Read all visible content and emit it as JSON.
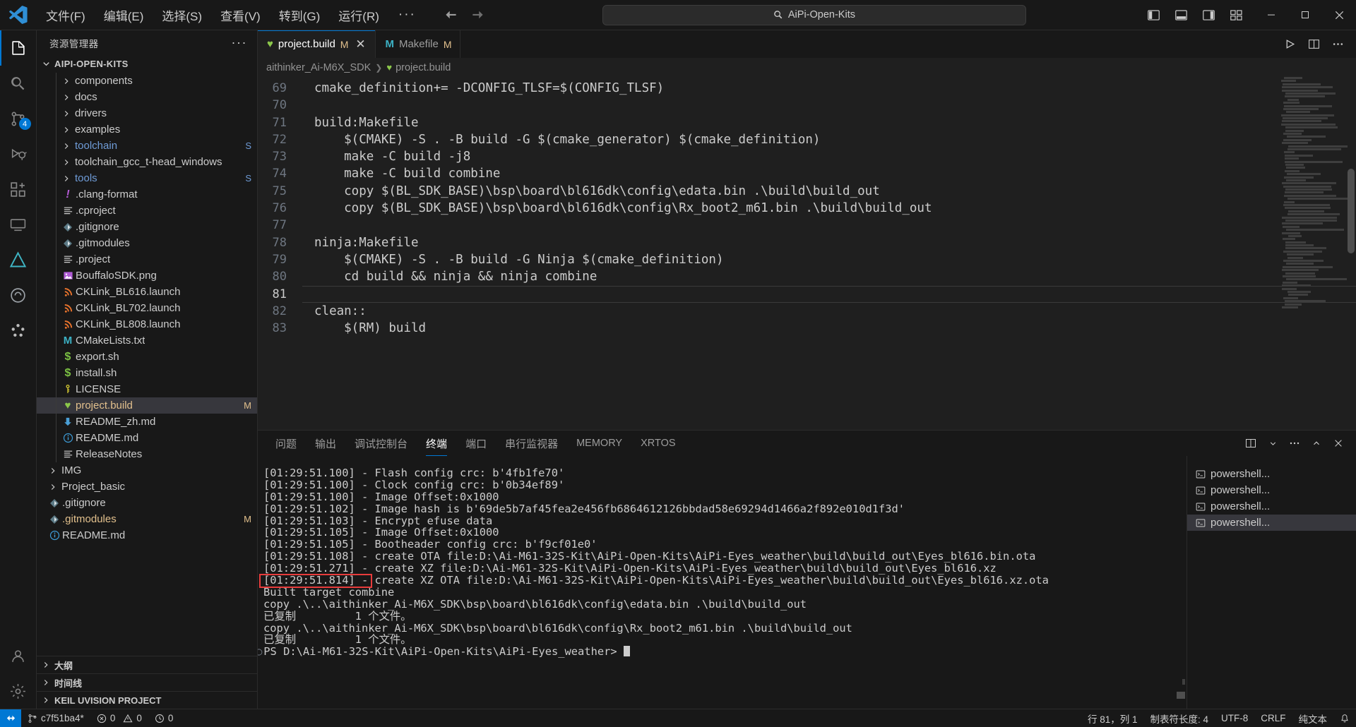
{
  "window": {
    "title": "AiPi-Open-Kits",
    "menu": [
      "文件(F)",
      "编辑(E)",
      "选择(S)",
      "查看(V)",
      "转到(G)",
      "运行(R)"
    ],
    "menu_overflow": "···",
    "search_placeholder": "AiPi-Open-Kits",
    "controls": {
      "minimize": "—",
      "maximize": "▢",
      "close": "✕"
    }
  },
  "activitybar": {
    "items": [
      {
        "name": "explorer",
        "badge": ""
      },
      {
        "name": "search",
        "badge": ""
      },
      {
        "name": "source-control",
        "badge": "4"
      },
      {
        "name": "run-and-debug",
        "badge": ""
      },
      {
        "name": "extensions",
        "badge": ""
      },
      {
        "name": "remote-explorer",
        "badge": ""
      },
      {
        "name": "platformio",
        "badge": ""
      },
      {
        "name": "copilot-chat",
        "badge": ""
      },
      {
        "name": "extension-pack",
        "badge": ""
      }
    ]
  },
  "explorer": {
    "header": "资源管理器",
    "header_more": "···",
    "root": "AIPI-OPEN-KITS",
    "items": [
      {
        "label": "components",
        "kind": "folder",
        "indent": 1,
        "badge": "",
        "color": ""
      },
      {
        "label": "docs",
        "kind": "folder",
        "indent": 1,
        "badge": "",
        "color": ""
      },
      {
        "label": "drivers",
        "kind": "folder",
        "indent": 1,
        "badge": "",
        "color": ""
      },
      {
        "label": "examples",
        "kind": "folder",
        "indent": 1,
        "badge": "",
        "color": ""
      },
      {
        "label": "toolchain",
        "kind": "folder",
        "indent": 1,
        "badge": "S",
        "color": "blue"
      },
      {
        "label": "toolchain_gcc_t-head_windows",
        "kind": "folder",
        "indent": 1,
        "badge": "",
        "color": ""
      },
      {
        "label": "tools",
        "kind": "folder",
        "indent": 1,
        "badge": "S",
        "color": "blue"
      },
      {
        "label": ".clang-format",
        "kind": "clang",
        "indent": 1,
        "badge": "",
        "color": ""
      },
      {
        "label": ".cproject",
        "kind": "xml",
        "indent": 1,
        "badge": "",
        "color": ""
      },
      {
        "label": ".gitignore",
        "kind": "git",
        "indent": 1,
        "badge": "",
        "color": ""
      },
      {
        "label": ".gitmodules",
        "kind": "git",
        "indent": 1,
        "badge": "",
        "color": ""
      },
      {
        "label": ".project",
        "kind": "xml",
        "indent": 1,
        "badge": "",
        "color": ""
      },
      {
        "label": "BouffaloSDK.png",
        "kind": "image",
        "indent": 1,
        "badge": "",
        "color": ""
      },
      {
        "label": "CKLink_BL616.launch",
        "kind": "launch",
        "indent": 1,
        "badge": "",
        "color": ""
      },
      {
        "label": "CKLink_BL702.launch",
        "kind": "launch",
        "indent": 1,
        "badge": "",
        "color": ""
      },
      {
        "label": "CKLink_BL808.launch",
        "kind": "launch",
        "indent": 1,
        "badge": "",
        "color": ""
      },
      {
        "label": "CMakeLists.txt",
        "kind": "cmake",
        "indent": 1,
        "badge": "",
        "color": ""
      },
      {
        "label": "export.sh",
        "kind": "shell",
        "indent": 1,
        "badge": "",
        "color": ""
      },
      {
        "label": "install.sh",
        "kind": "shell",
        "indent": 1,
        "badge": "",
        "color": ""
      },
      {
        "label": "LICENSE",
        "kind": "license",
        "indent": 1,
        "badge": "",
        "color": ""
      },
      {
        "label": "project.build",
        "kind": "build",
        "indent": 1,
        "badge": "M",
        "color": "mod",
        "selected": true
      },
      {
        "label": "README_zh.md",
        "kind": "mddown",
        "indent": 1,
        "badge": "",
        "color": ""
      },
      {
        "label": "README.md",
        "kind": "mdinfo",
        "indent": 1,
        "badge": "",
        "color": ""
      },
      {
        "label": "ReleaseNotes",
        "kind": "xml",
        "indent": 1,
        "badge": "",
        "color": ""
      },
      {
        "label": "IMG",
        "kind": "folder",
        "indent": 0,
        "badge": "",
        "color": ""
      },
      {
        "label": "Project_basic",
        "kind": "folder",
        "indent": 0,
        "badge": "",
        "color": ""
      },
      {
        "label": ".gitignore",
        "kind": "git",
        "indent": 0,
        "badge": "",
        "color": ""
      },
      {
        "label": ".gitmodules",
        "kind": "git",
        "indent": 0,
        "badge": "M",
        "color": "mod"
      },
      {
        "label": "README.md",
        "kind": "mdinfo",
        "indent": 0,
        "badge": "",
        "color": ""
      }
    ],
    "bottom_sections": [
      "大纲",
      "时间线",
      "KEIL UVISION PROJECT"
    ]
  },
  "editor": {
    "tabs": [
      {
        "label": "project.build",
        "badge": "M",
        "icon": "build-icon",
        "active": true,
        "closable": true
      },
      {
        "label": "Makefile",
        "badge": "M",
        "icon": "cmake-icon",
        "active": false,
        "closable": false
      }
    ],
    "actions": [
      "run-icon",
      "split-editor-icon",
      "more-actions-icon"
    ],
    "breadcrumb": [
      "aithinker_Ai-M6X_SDK",
      "project.build"
    ],
    "lines": [
      {
        "num": 69,
        "text": "cmake_definition+= -DCONFIG_TLSF=$(CONFIG_TLSF)",
        "changed": false
      },
      {
        "num": 70,
        "text": "",
        "changed": false
      },
      {
        "num": 71,
        "text": "build:Makefile",
        "changed": false
      },
      {
        "num": 72,
        "text": "    $(CMAKE) -S . -B build -G $(cmake_generator) $(cmake_definition)",
        "changed": false
      },
      {
        "num": 73,
        "text": "    make -C build -j8",
        "changed": false
      },
      {
        "num": 74,
        "text": "    make -C build combine",
        "changed": false
      },
      {
        "num": 75,
        "text": "    copy $(BL_SDK_BASE)\\bsp\\board\\bl616dk\\config\\edata.bin .\\build\\build_out",
        "changed": true
      },
      {
        "num": 76,
        "text": "    copy $(BL_SDK_BASE)\\bsp\\board\\bl616dk\\config\\Rx_boot2_m61.bin .\\build\\build_out",
        "changed": true
      },
      {
        "num": 77,
        "text": "",
        "changed": false
      },
      {
        "num": 78,
        "text": "ninja:Makefile",
        "changed": false
      },
      {
        "num": 79,
        "text": "    $(CMAKE) -S . -B build -G Ninja $(cmake_definition)",
        "changed": false
      },
      {
        "num": 80,
        "text": "    cd build && ninja && ninja combine",
        "changed": false
      },
      {
        "num": 81,
        "text": "",
        "changed": false,
        "current": true
      },
      {
        "num": 82,
        "text": "clean::",
        "changed": false
      },
      {
        "num": 83,
        "text": "    $(RM) build",
        "changed": false
      }
    ]
  },
  "panel": {
    "tabs": [
      {
        "label": "问题",
        "active": false,
        "cjk": true
      },
      {
        "label": "输出",
        "active": false,
        "cjk": true
      },
      {
        "label": "调试控制台",
        "active": false,
        "cjk": true
      },
      {
        "label": "终端",
        "active": true,
        "cjk": true
      },
      {
        "label": "端口",
        "active": false,
        "cjk": true
      },
      {
        "label": "串行监视器",
        "active": false,
        "cjk": true
      },
      {
        "label": "MEMORY",
        "active": false,
        "cjk": false
      },
      {
        "label": "XRTOS",
        "active": false,
        "cjk": false
      }
    ],
    "actions": [
      "split-terminal-icon",
      "chevron-down-icon",
      "more-actions-icon",
      "chevron-up-icon",
      "close-panel-icon"
    ],
    "terminal_lines": [
      "[01:29:51.100] - Flash config crc: b'4fb1fe70'",
      "[01:29:51.100] - Clock config crc: b'0b34ef89'",
      "[01:29:51.100] - Image Offset:0x1000",
      "[01:29:51.102] - Image hash is b'69de5b7af45fea2e456fb6864612126bbdad58e69294d1466a2f892e010d1f3d'",
      "[01:29:51.103] - Encrypt efuse data",
      "[01:29:51.105] - Image Offset:0x1000",
      "[01:29:51.105] - Bootheader config crc: b'f9cf01e0'",
      "[01:29:51.108] - create OTA file:D:\\Ai-M61-32S-Kit\\AiPi-Open-Kits\\AiPi-Eyes_weather\\build\\build_out\\Eyes_bl616.bin.ota",
      "[01:29:51.271] - create XZ file:D:\\Ai-M61-32S-Kit\\AiPi-Open-Kits\\AiPi-Eyes_weather\\build\\build_out\\Eyes_bl616.xz",
      "[01:29:51.814] - create XZ OTA file:D:\\Ai-M61-32S-Kit\\AiPi-Open-Kits\\AiPi-Eyes_weather\\build\\build_out\\Eyes_bl616.xz.ota",
      "Built target combine",
      "copy .\\..\\aithinker_Ai-M6X_SDK\\bsp\\board\\bl616dk\\config\\edata.bin .\\build\\build_out",
      "已复制         1 个文件。",
      "copy .\\..\\aithinker_Ai-M6X_SDK\\bsp\\board\\bl616dk\\config\\Rx_boot2_m61.bin .\\build\\build_out",
      "已复制         1 个文件。",
      "PS D:\\Ai-M61-32S-Kit\\AiPi-Open-Kits\\AiPi-Eyes_weather> "
    ],
    "highlight_line_index": 10,
    "highlight_color": "#e83c3c",
    "terminal_list": [
      {
        "label": "powershell...",
        "active": false
      },
      {
        "label": "powershell...",
        "active": false
      },
      {
        "label": "powershell...",
        "active": false
      },
      {
        "label": "powershell...",
        "active": true
      }
    ]
  },
  "statusbar": {
    "branch": "c7f51ba4*",
    "errors": "0",
    "warnings": "0",
    "ports": "0",
    "cursor": "行 81，列 1",
    "indent": "制表符长度: 4",
    "encoding": "UTF-8",
    "eol": "CRLF",
    "language": "纯文本"
  },
  "colors": {
    "accent": "#0078d4",
    "modified": "#e2c08d",
    "highlight": "#e83c3c",
    "bg": "#1f1f1f",
    "panel_bg": "#181818"
  }
}
